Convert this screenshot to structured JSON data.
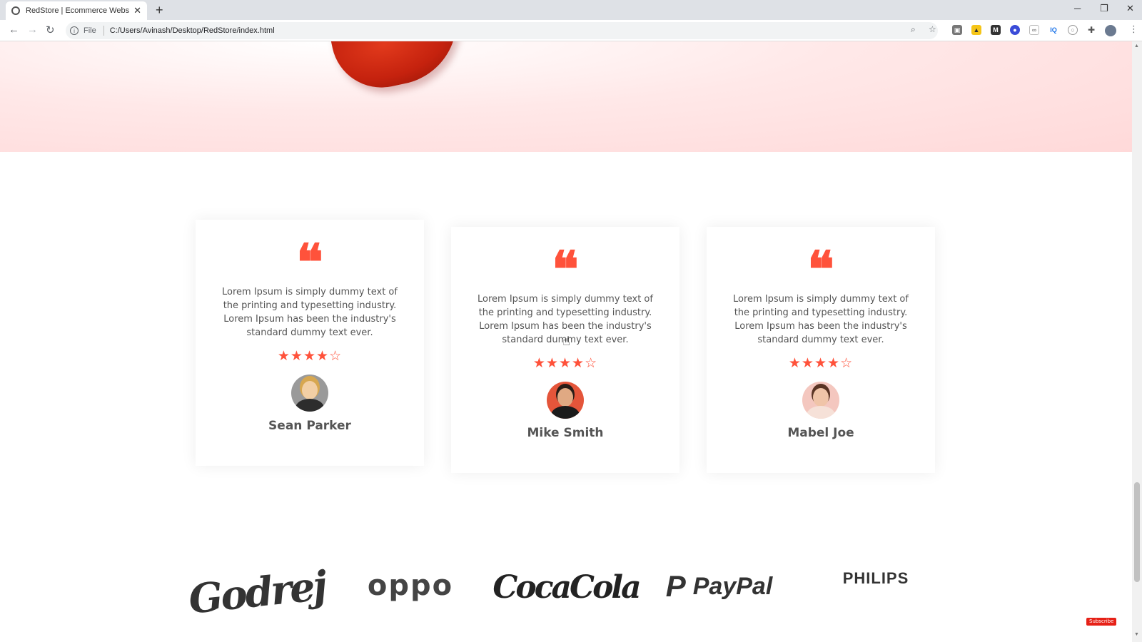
{
  "browser": {
    "tab_title": "RedStore | Ecommerce Website D",
    "address_scheme": "File",
    "address_url": "C:/Users/Avinash/Desktop/RedStore/index.html"
  },
  "testimonials": [
    {
      "text": "Lorem Ipsum is simply dummy text of the printing and typesetting industry. Lorem Ipsum has been the industry's standard dummy text ever.",
      "rating": 4,
      "rating_max": 5,
      "name": "Sean Parker"
    },
    {
      "text": "Lorem Ipsum is simply dummy text of the printing and typesetting industry. Lorem Ipsum has been the industry's standard dummy text ever.",
      "rating": 4,
      "rating_max": 5,
      "name": "Mike Smith"
    },
    {
      "text": "Lorem Ipsum is simply dummy text of the printing and typesetting industry. Lorem Ipsum has been the industry's standard dummy text ever.",
      "rating": 4,
      "rating_max": 5,
      "name": "Mabel Joe"
    }
  ],
  "brands": {
    "godrej": "Godrej",
    "oppo": "oppo",
    "cocacola": "CocaCola",
    "paypal": "PayPal",
    "philips": "PHILIPS"
  },
  "overlay": {
    "subscribe_label": "Subscribe"
  },
  "colors": {
    "accent": "#ff523b",
    "offer_background": "#ffd9d9"
  },
  "icons": {
    "quote": "left-quote-icon",
    "star_filled": "star-filled-icon",
    "star_empty": "star-empty-icon"
  }
}
